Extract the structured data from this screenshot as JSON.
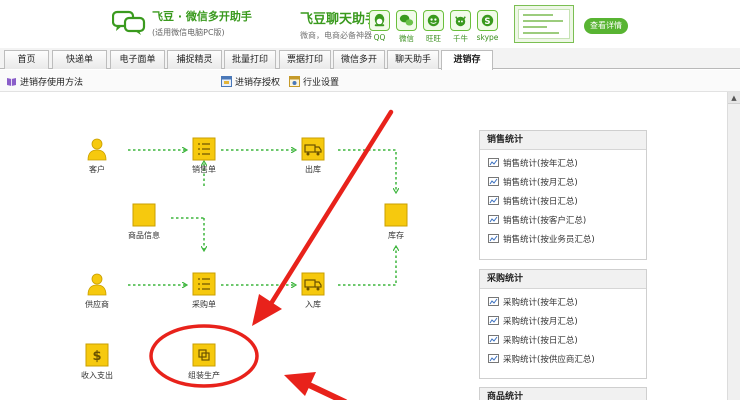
{
  "banner": {
    "brand_title": "飞豆 · 微信多开助手",
    "brand_sub": "(适用微信电脑PC版)",
    "product_title": "飞豆聊天助手",
    "product_sub": "微商，电商必备神器",
    "apps": [
      {
        "icon": "qq-icon",
        "label": "QQ"
      },
      {
        "icon": "wechat-icon",
        "label": "微信"
      },
      {
        "icon": "wangwang-icon",
        "label": "旺旺"
      },
      {
        "icon": "qianniu-icon",
        "label": "千牛"
      },
      {
        "icon": "skype-icon",
        "label": "skype"
      }
    ],
    "details_label": "查看详情"
  },
  "tabs": [
    {
      "label": "首页",
      "active": false
    },
    {
      "label": "快递单",
      "active": false
    },
    {
      "label": "电子面单",
      "active": false
    },
    {
      "label": "捕捉精灵",
      "active": false
    },
    {
      "label": "批量打印",
      "active": false
    },
    {
      "label": "票据打印",
      "active": false
    },
    {
      "label": "微信多开",
      "active": false
    },
    {
      "label": "聊天助手",
      "active": false
    },
    {
      "label": "进销存",
      "active": true
    }
  ],
  "toolbar": {
    "usage_label": "进销存使用方法",
    "auth_label": "进销存授权",
    "industry_label": "行业设置"
  },
  "flow": {
    "nodes": {
      "customer": "客户",
      "sales_order": "销售单",
      "outbound": "出库",
      "product_info": "商品信息",
      "inventory": "库存",
      "supplier": "供应商",
      "purchase_order": "采购单",
      "inbound": "入库",
      "income_expense": "收入支出",
      "assembly": "组装生产"
    }
  },
  "panels": {
    "sales": {
      "title": "销售统计",
      "items": [
        "销售统计(按年汇总)",
        "销售统计(按月汇总)",
        "销售统计(按日汇总)",
        "销售统计(按客户汇总)",
        "销售统计(按业务员汇总)"
      ]
    },
    "purchase": {
      "title": "采购统计",
      "items": [
        "采购统计(按年汇总)",
        "采购统计(按月汇总)",
        "采购统计(按日汇总)",
        "采购统计(按供应商汇总)"
      ]
    },
    "goods": {
      "title": "商品统计"
    }
  },
  "colors": {
    "brand_green": "#3a9a1e",
    "node_yellow": "#f6c90e",
    "flow_green": "#3db53d",
    "annotation_red": "#e8221b"
  }
}
